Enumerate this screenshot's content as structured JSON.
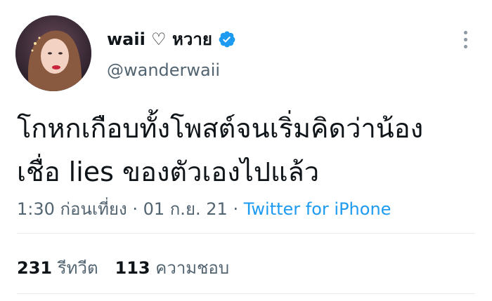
{
  "user": {
    "display_name": "waii ♡ หวาย",
    "handle": "@wanderwaii",
    "verified_icon": "verified-badge-icon"
  },
  "tweet": {
    "lines": [
      "โกหกเกือบทั้งโพสต์จนเริ่มคิดว่าน้อง",
      "เชื่อ lies ของตัวเองไปแล้ว"
    ],
    "time": "1:30 ก่อนเที่ยง",
    "separator": "·",
    "date": "01 ก.ย. 21",
    "source": "Twitter for iPhone"
  },
  "stats": {
    "retweets_count": "231",
    "retweets_label": "รีทวีต",
    "likes_count": "113",
    "likes_label": "ความชอบ"
  },
  "colors": {
    "link": "#1d9bf0",
    "secondary_text": "#536471",
    "primary_text": "#0f1419"
  }
}
